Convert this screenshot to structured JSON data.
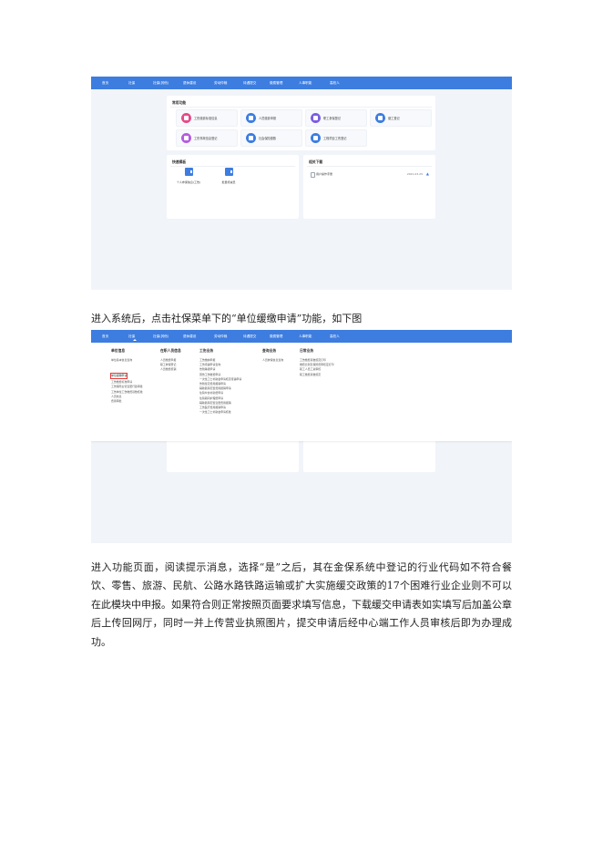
{
  "nav": [
    "首页",
    "社保",
    "社保(其他)",
    "退休建设",
    "劳动仲裁",
    "待遇提交",
    "缴费管理",
    "人事职能",
    "高校人"
  ],
  "shot1": {
    "common_title": "常用功能",
    "tiles": [
      {
        "label": "工伤缴费标准信息",
        "color": "#e64a8a"
      },
      {
        "label": "人员缴费申报",
        "color": "#3d7de0"
      },
      {
        "label": "职工参保登记",
        "color": "#7c5ce0"
      },
      {
        "label": "缴工登记",
        "color": "#3d7de0"
      },
      {
        "label": "工伤事故信息登记",
        "color": "#b45ce0"
      },
      {
        "label": "社会保险基数",
        "color": "#3d7de0"
      },
      {
        "label": "工程项目工伤登记",
        "color": "#3d7de0"
      }
    ],
    "quick_title": "快速模板",
    "quick": [
      "个人参保信息(工伤)",
      "批量增减员"
    ],
    "download_title": "相关下载",
    "downloads": [
      {
        "name": "用户操作手册",
        "date": "2021.03.29"
      }
    ]
  },
  "caption1": "进入系统后，点击社保菜单下的“单位缓缴申请”功能，如下图",
  "shot2": {
    "columns": [
      {
        "head": "单位信息",
        "items": [
          "单位基本信息查询",
          "单位缓缴申请",
          "工伤缴费标准申请",
          "工伤保险主管变更行政审批",
          "工伤单位工伤缴费基数核准",
          "人员信息",
          "费用审批"
        ]
      },
      {
        "head": "在职人员信息",
        "items": [
          "人员缴费申报",
          "职工参保登记",
          "人员缴费核销"
        ]
      },
      {
        "head": "工伤业务",
        "items": [
          "工伤缴纳申报",
          "工伤待遇申请查询",
          "伤残等级申请",
          "因伤工伤缴费申请",
          "一次性工亡补助金申请核定待遇申请",
          "伤残鉴定费用报销申请",
          "辅助器具配置费用报销申请",
          "住院伙食补助费申请",
          "住院期间护理费申请",
          "辅助器具配置变更费用报销",
          "工伤医疗费用报销申请",
          "一次性工亡补助金申请核准"
        ]
      },
      {
        "head": "查询业务",
        "items": [
          "人员参保信息查询"
        ]
      },
      {
        "head": "日常业务",
        "items": [
          "工伤缴费基数核定打印",
          "缴费比例及保险费率核定打印",
          "职工人员工资审核",
          "职工缴费基数核定"
        ]
      }
    ],
    "highlighted": "单位缓缴申请"
  },
  "paragraph": "进入功能页面，阅读提示消息，选择“是”之后，其在金保系统中登记的行业代码如不符合餐饮、零售、旅游、民航、公路水路铁路运输或扩大实施缓交政策的17个困难行业企业则不可以在此模块中申报。如果符合则正常按照页面要求填写信息，下载缓交申请表如实填写后加盖公章后上传回网厅，同时一并上传营业执照图片，提交申请后经中心端工作人员审核后即为办理成功。",
  "accent": "#3d7de0"
}
